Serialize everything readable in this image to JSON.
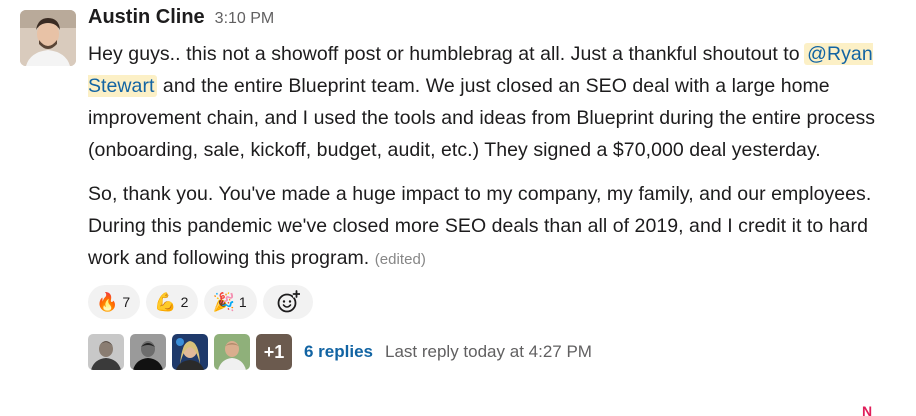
{
  "message": {
    "author": "Austin Cline",
    "time": "3:10 PM",
    "paragraph1": {
      "part1": "Hey guys.. this not a showoff post or humblebrag at all. Just a thankful shoutout to ",
      "mention": "@Ryan Stewart",
      "part2": " and the entire Blueprint team. We just closed an SEO deal with a large home improvement chain, and I used the tools and ideas from Blueprint during the entire process (onboarding, sale, kickoff, budget, audit, etc.) They signed a $70,000 deal yesterday."
    },
    "paragraph2": "So, thank you. You've made a huge impact to my company, my family, and our employees. During this pandemic we've closed more SEO deals than all of 2019, and I credit it to hard work and following this program.",
    "edited_label": "(edited)"
  },
  "reactions": [
    {
      "icon": "fire-icon",
      "emoji": "🔥",
      "count": "7"
    },
    {
      "icon": "flexed-biceps-icon",
      "emoji": "💪",
      "count": "2"
    },
    {
      "icon": "party-popper-icon",
      "emoji": "🎉",
      "count": "1"
    }
  ],
  "add_reaction_icon": "add-reaction-icon",
  "thread": {
    "more_count": "+1",
    "replies": "6 replies",
    "last_reply": "Last reply today at 4:27 PM"
  },
  "colors": {
    "link": "#1264a3",
    "mention_bg": "#fcf0c6",
    "reaction_bg": "#f2f2f2",
    "muted": "#616061"
  }
}
